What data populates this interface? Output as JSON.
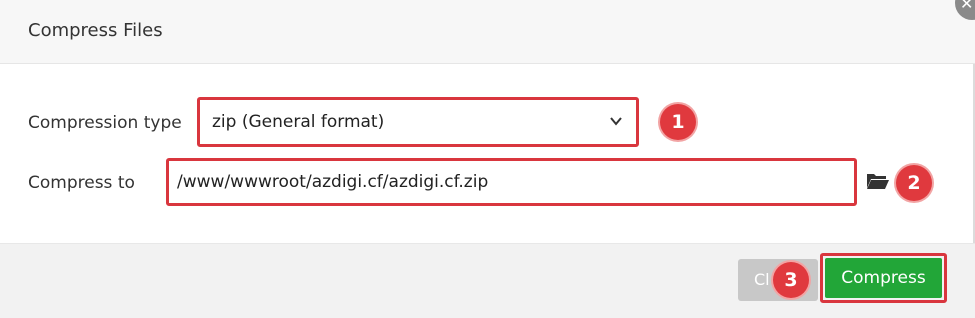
{
  "dialog": {
    "title": "Compress Files",
    "close_icon": "close-icon"
  },
  "form": {
    "compression_type_label": "Compression type",
    "compression_type_value": "zip (General format)",
    "compress_to_label": "Compress to",
    "compress_to_value": "/www/wwwroot/azdigi.cf/azdigi.cf.zip",
    "folder_icon": "folder-open-icon"
  },
  "annotations": {
    "badge_1": "1",
    "badge_2": "2",
    "badge_3": "3",
    "badge_color": "#e0393e",
    "highlight_color": "#d9363e"
  },
  "footer": {
    "cancel_label": "Cl",
    "compress_label": "Compress",
    "compress_color": "#22a638"
  }
}
